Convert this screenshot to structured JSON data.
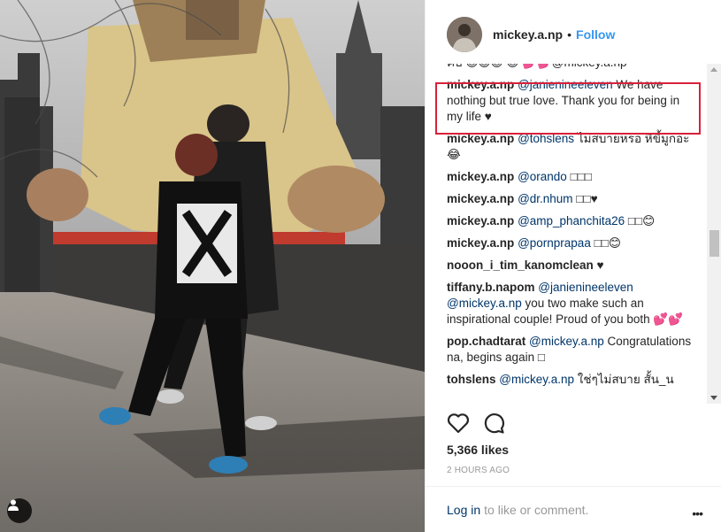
{
  "post": {
    "username": "mickey.a.np",
    "separator": "•",
    "follow_label": "Follow",
    "likes": "5,366 likes",
    "time_ago": "2 HOURS AGO"
  },
  "comments": {
    "truncated_first_line": "คบ 😊😊😊 😊 💕💕@mickey.a.np",
    "items": [
      {
        "author": "mickey.a.np",
        "mention": "@janienineeleven",
        "text": " We have nothing but true love. Thank you for being in my life ♥"
      },
      {
        "author": "mickey.a.np",
        "mention": "@tohslens",
        "text": " ไม่สบายหรอ หึขี้มูกอะ 😂"
      },
      {
        "author": "mickey.a.np",
        "mention": "@orando",
        "text": " □□□"
      },
      {
        "author": "mickey.a.np",
        "mention": "@dr.nhum",
        "text": " □□♥"
      },
      {
        "author": "mickey.a.np",
        "mention": "@amp_phanchita26",
        "text": " □□😊"
      },
      {
        "author": "mickey.a.np",
        "mention": "@pornprapaa",
        "text": " □□😊"
      },
      {
        "author": "nooon_i_tim_kanomclean",
        "mention": "",
        "text": " ♥"
      },
      {
        "author": "tiffany.b.napom",
        "mention": "@janienineeleven @mickey.a.np",
        "text": " you two make such an inspirational couple! Proud of you both 💕💕"
      },
      {
        "author": "pop.chadtarat",
        "mention": "@mickey.a.np",
        "text": " Congratulations na, begins again □"
      },
      {
        "author": "tohslens",
        "mention": "@mickey.a.np",
        "text": " ใช่ๆไม่สบาย สั้น_น"
      }
    ]
  },
  "footer": {
    "login_label": "Log in",
    "login_rest": "to like or comment.",
    "more_label": "•••"
  },
  "icons": {
    "heart": "heart-icon",
    "comment": "comment-icon",
    "tag": "user-tag-icon",
    "more": "more-options-icon"
  },
  "colors": {
    "link_blue": "#3897f0",
    "mention": "#003569",
    "highlight": "#d9213a"
  }
}
